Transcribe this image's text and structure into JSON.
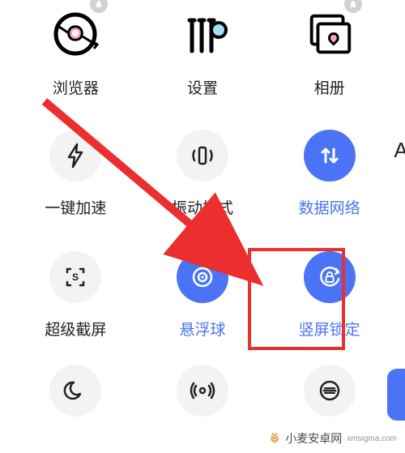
{
  "apps": {
    "browser": {
      "label": "浏览器"
    },
    "settings": {
      "label": "设置"
    },
    "gallery": {
      "label": "相册"
    }
  },
  "toggles": {
    "boost": {
      "label": "一键加速",
      "active": false
    },
    "vibrate": {
      "label": "振动模式",
      "active": false
    },
    "data": {
      "label": "数据网络",
      "active": true
    },
    "screenshot": {
      "label": "超级截屏",
      "active": false
    },
    "floatball": {
      "label": "悬浮球",
      "active": true
    },
    "portraitlock": {
      "label": "竖屏锁定",
      "active": true
    }
  },
  "peek": {
    "letter": "A"
  },
  "watermark": {
    "text": "小麦安卓网",
    "domain": "xmsigma.com"
  }
}
